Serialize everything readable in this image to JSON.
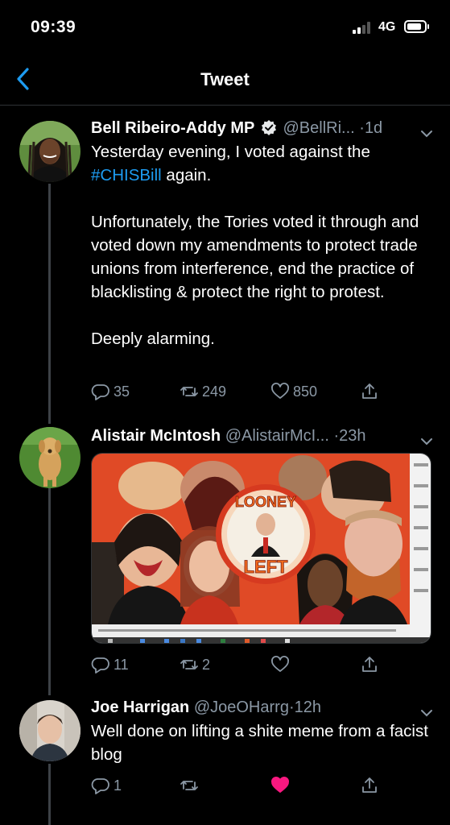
{
  "status_bar": {
    "time": "09:39",
    "network": "4G"
  },
  "nav": {
    "title": "Tweet"
  },
  "tweets": [
    {
      "name": "Bell Ribeiro-Addy MP",
      "handle": "@BellRi...",
      "separator": "·",
      "time_ago": "1d",
      "verified": true,
      "text_1": "Yesterday evening, I voted against the",
      "hashtag": "#CHISBill",
      "text_1b": " again.",
      "text_2": "Unfortunately, the Tories voted it through and voted down my amendments to protect trade unions from interference, end the practice of blacklisting & protect the right to protest.",
      "text_3": "Deeply alarming.",
      "replies": "35",
      "retweets": "249",
      "likes": "850"
    },
    {
      "name": "Alistair McIntosh",
      "handle": "@AlistairMcI...",
      "separator": "·",
      "time_ago": "23h",
      "media_caption": "LOONEY LEFT",
      "replies": "11",
      "retweets": "2",
      "likes": ""
    },
    {
      "name": "Joe Harrigan",
      "handle": "@JoeOHarrg",
      "separator": "·",
      "time_ago": "12h",
      "text_1": "Well done on lifting a shite meme from a facist blog",
      "replies": "1",
      "retweets": "",
      "likes": "",
      "liked": true
    }
  ],
  "colors": {
    "accent": "#1d9bf0",
    "muted": "#8b98a5",
    "like": "#f91880",
    "background": "#000000"
  },
  "icons": [
    "back-chevron-icon",
    "verified-badge-icon",
    "caret-down-icon",
    "reply-icon",
    "retweet-icon",
    "like-icon",
    "share-icon"
  ]
}
